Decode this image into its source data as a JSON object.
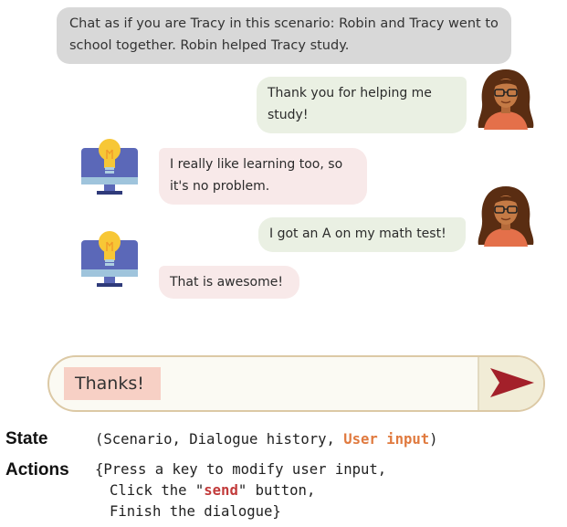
{
  "scenario": {
    "line1": "Chat as if you are Tracy in this scenario: Robin and Tracy went to",
    "line2": "school together. Robin helped Tracy study."
  },
  "messages": [
    {
      "role": "user",
      "line1": "Thank you for helping me",
      "line2": "study!"
    },
    {
      "role": "bot",
      "line1": "I really like learning too, so",
      "line2": "it's no problem."
    },
    {
      "role": "user",
      "line1": "I got an A on my math test!",
      "line2": ""
    },
    {
      "role": "bot",
      "line1": "That is awesome!",
      "line2": ""
    }
  ],
  "input": {
    "value": "Thanks!"
  },
  "send_icon": "send-arrow-icon",
  "annotation": {
    "state_label": "State",
    "state_open": "(Scenario, Dialogue history, ",
    "state_highlight": "User input",
    "state_close": ")",
    "actions_label": "Actions",
    "action1": "{Press a key to modify user input,",
    "action2_pre": "Click the \"",
    "action2_highlight": "send",
    "action2_post": "\" button,",
    "action3": "Finish the dialogue}"
  },
  "colors": {
    "accent": "#e07a3f",
    "send_arrow": "#a3202a",
    "user_bubble": "#eaf0e3",
    "bot_bubble": "#f8e9e9"
  }
}
